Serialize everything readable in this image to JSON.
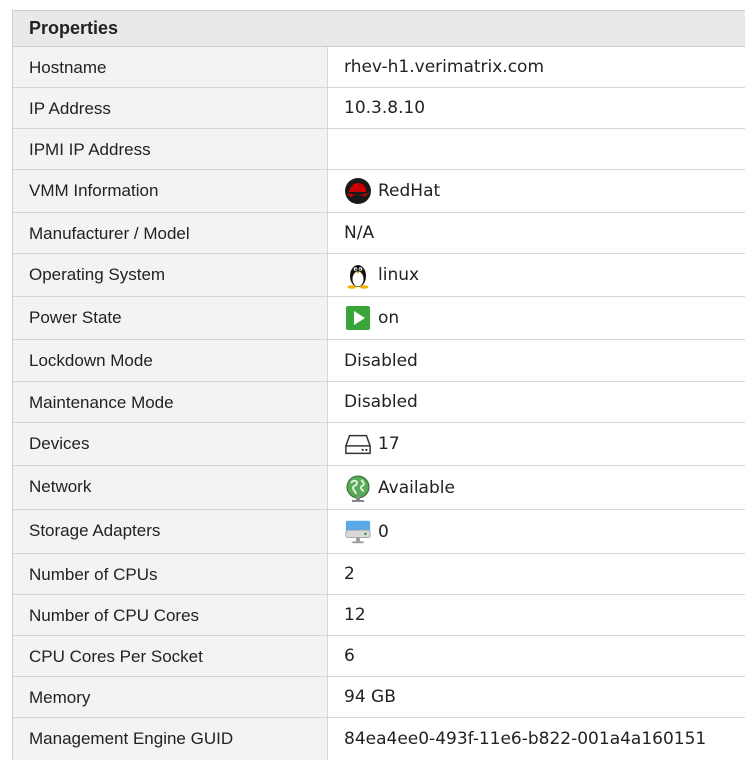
{
  "panel": {
    "title": "Properties"
  },
  "rows": [
    {
      "label": "Hostname",
      "value": "rhev-h1.verimatrix.com",
      "icon": ""
    },
    {
      "label": "IP Address",
      "value": "10.3.8.10",
      "icon": ""
    },
    {
      "label": "IPMI IP Address",
      "value": "",
      "icon": ""
    },
    {
      "label": "VMM Information",
      "value": "RedHat",
      "icon": "redhat-logo-icon"
    },
    {
      "label": "Manufacturer / Model",
      "value": "N/A",
      "icon": ""
    },
    {
      "label": "Operating System",
      "value": "linux",
      "icon": "linux-penguin-icon"
    },
    {
      "label": "Power State",
      "value": "on",
      "icon": "play-icon"
    },
    {
      "label": "Lockdown Mode",
      "value": "Disabled",
      "icon": ""
    },
    {
      "label": "Maintenance Mode",
      "value": "Disabled",
      "icon": ""
    },
    {
      "label": "Devices",
      "value": "17",
      "icon": "hard-drive-icon"
    },
    {
      "label": "Network",
      "value": "Available",
      "icon": "globe-network-icon"
    },
    {
      "label": "Storage Adapters",
      "value": "0",
      "icon": "storage-adapter-icon"
    },
    {
      "label": "Number of CPUs",
      "value": "2",
      "icon": ""
    },
    {
      "label": "Number of CPU Cores",
      "value": "12",
      "icon": ""
    },
    {
      "label": "CPU Cores Per Socket",
      "value": "6",
      "icon": ""
    },
    {
      "label": "Memory",
      "value": "94 GB",
      "icon": ""
    },
    {
      "label": "Management Engine GUID",
      "value": "84ea4ee0-493f-11e6-b822-001a4a160151",
      "icon": ""
    }
  ],
  "colors": {
    "header_bg": "#e9e9e9",
    "label_bg": "#f3f3f3",
    "border": "#d6d6d6",
    "play_green": "#3aa53a",
    "redhat_red": "#cc0000"
  }
}
